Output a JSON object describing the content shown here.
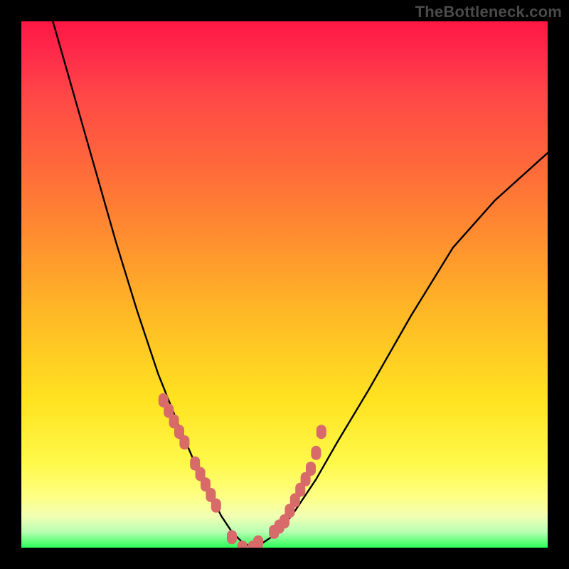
{
  "watermark": "TheBottleneck.com",
  "chart_data": {
    "type": "line",
    "title": "",
    "xlabel": "",
    "ylabel": "",
    "xlim": [
      0,
      100
    ],
    "ylim": [
      0,
      100
    ],
    "grid": false,
    "legend": false,
    "annotations": [],
    "series": [
      {
        "name": "curve",
        "x": [
          6,
          10,
          14,
          18,
          22,
          26,
          30,
          33,
          36,
          38,
          40,
          42,
          44,
          46,
          49,
          52,
          56,
          60,
          66,
          74,
          82,
          90,
          100
        ],
        "y": [
          100,
          86,
          72,
          58,
          45,
          33,
          23,
          16,
          10,
          6,
          3,
          1,
          0,
          1,
          3,
          7,
          13,
          20,
          30,
          44,
          57,
          66,
          75
        ]
      }
    ],
    "markers": {
      "name": "highlight-points",
      "x": [
        27,
        28,
        29,
        30,
        31,
        33,
        34,
        35,
        36,
        37,
        40,
        42,
        44,
        45,
        48,
        49,
        50,
        51,
        52,
        53,
        54,
        55,
        56,
        57
      ],
      "y": [
        28,
        26,
        24,
        22,
        20,
        16,
        14,
        12,
        10,
        8,
        2,
        0,
        0,
        1,
        3,
        4,
        5,
        7,
        9,
        11,
        13,
        15,
        18,
        22
      ],
      "color": "#d86a6a"
    },
    "background_gradient": {
      "direction": "vertical",
      "stops": [
        {
          "offset": 0.0,
          "color": "#ff1744"
        },
        {
          "offset": 0.55,
          "color": "#ffb726"
        },
        {
          "offset": 0.84,
          "color": "#fff94a"
        },
        {
          "offset": 1.0,
          "color": "#2bff57"
        }
      ]
    }
  }
}
